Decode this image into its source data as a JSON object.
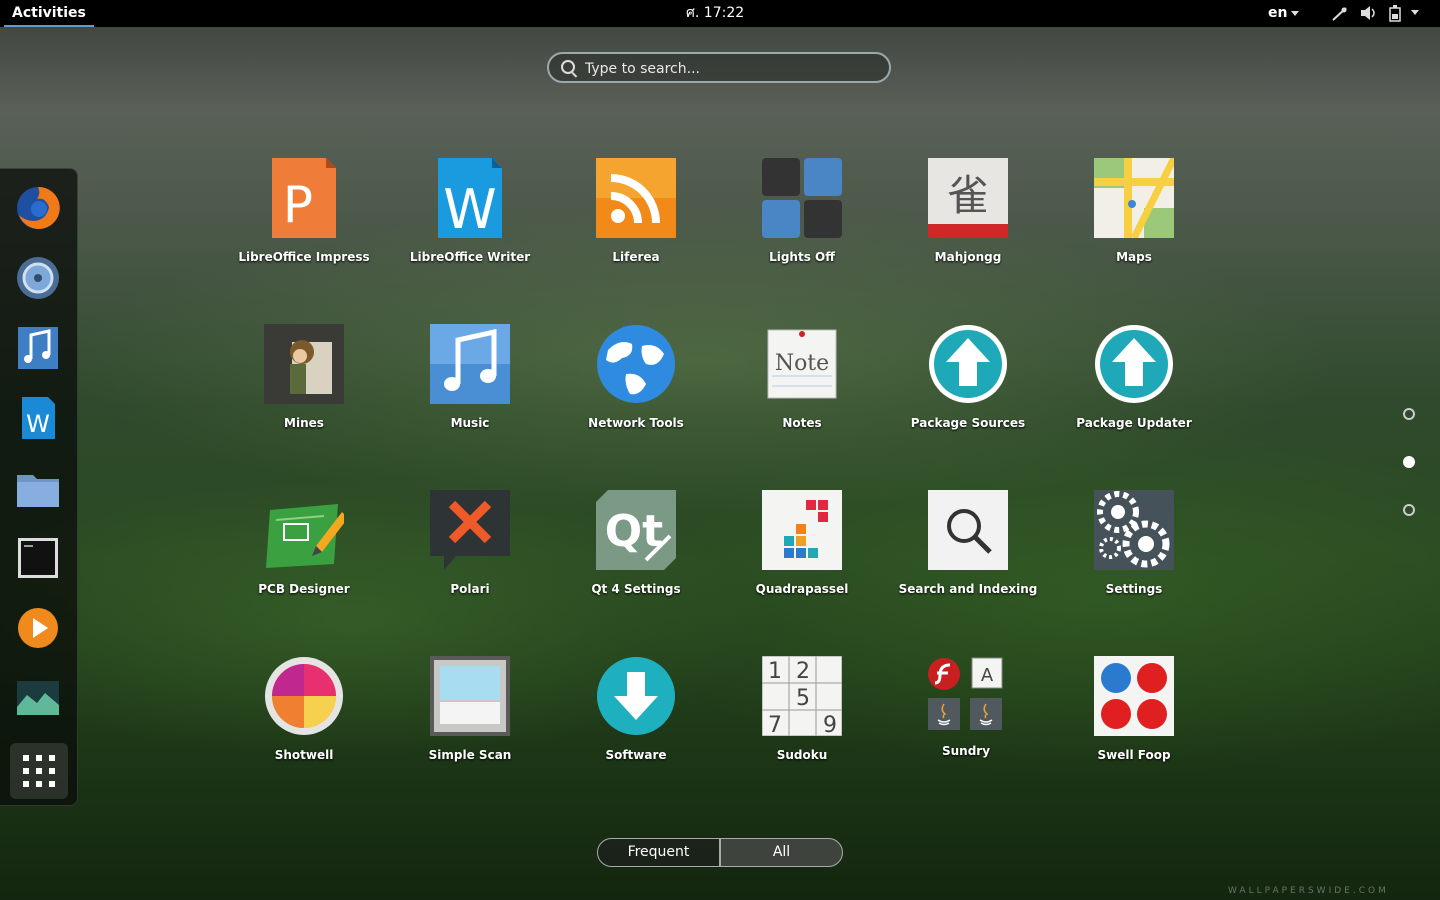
{
  "topbar": {
    "activities": "Activities",
    "clock": "ศ. 17:22",
    "language": "en"
  },
  "search": {
    "placeholder": "Type to search..."
  },
  "dash": {
    "items": [
      "firefox-icon",
      "disc-icon",
      "music-note-icon",
      "writer-icon",
      "folder-icon",
      "terminal-icon",
      "media-player-icon",
      "image-viewer-icon",
      "show-apps-icon"
    ]
  },
  "apps": [
    {
      "label": "LibreOffice Impress"
    },
    {
      "label": "LibreOffice Writer"
    },
    {
      "label": "Liferea"
    },
    {
      "label": "Lights Off"
    },
    {
      "label": "Mahjongg"
    },
    {
      "label": "Maps"
    },
    {
      "label": "Mines"
    },
    {
      "label": "Music"
    },
    {
      "label": "Network Tools"
    },
    {
      "label": "Notes"
    },
    {
      "label": "Package Sources"
    },
    {
      "label": "Package Updater"
    },
    {
      "label": "PCB Designer"
    },
    {
      "label": "Polari"
    },
    {
      "label": "Qt 4 Settings"
    },
    {
      "label": "Quadrapassel"
    },
    {
      "label": "Search and Indexing"
    },
    {
      "label": "Settings"
    },
    {
      "label": "Shotwell"
    },
    {
      "label": "Simple Scan"
    },
    {
      "label": "Software"
    },
    {
      "label": "Sudoku"
    },
    {
      "label": "Sundry"
    },
    {
      "label": "Swell Foop"
    }
  ],
  "icon_text": {
    "impress_letter": "P",
    "writer_letter": "W",
    "mahjongg_glyph": "雀",
    "notes_word": "Note",
    "qt_word": "Qt",
    "sudoku": [
      "1",
      "2",
      "5",
      "7",
      "9"
    ],
    "sundry_letter": "A"
  },
  "view_switcher": {
    "frequent": "Frequent",
    "all": "All",
    "active": "All"
  },
  "pager": {
    "pages": 3,
    "active_index": 1
  },
  "watermark": "WALLPAPERSWIDE.COM"
}
